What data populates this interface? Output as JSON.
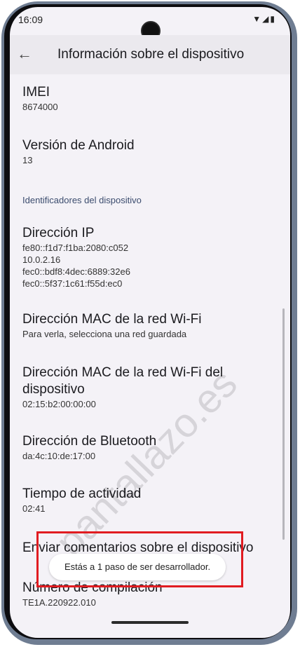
{
  "status_bar": {
    "time": "16:09",
    "icons": "wifi-icon signal-icon battery-icon"
  },
  "header": {
    "back_icon": "arrow-back-icon",
    "title": "Información sobre el dispositivo"
  },
  "items": [
    {
      "title": "IMEI",
      "lines": [
        "8674000"
      ]
    },
    {
      "title": "Versión de Android",
      "lines": [
        "13"
      ]
    },
    {
      "section": "Identificadores del dispositivo"
    },
    {
      "title": "Dirección IP",
      "lines": [
        "fe80::f1d7:f1ba:2080:c052",
        "10.0.2.16",
        "fec0::bdf8:4dec:6889:32e6",
        "fec0::5f37:1c61:f55d:ec0"
      ]
    },
    {
      "title": "Dirección MAC de la red Wi-Fi",
      "lines": [
        "Para verla, selecciona una red guardada"
      ]
    },
    {
      "title": "Dirección MAC de la red Wi-Fi del dispositivo",
      "lines": [
        "02:15:b2:00:00:00"
      ]
    },
    {
      "title": "Dirección de Bluetooth",
      "lines": [
        "da:4c:10:de:17:00"
      ]
    },
    {
      "title": "Tiempo de actividad",
      "lines": [
        "02:41"
      ]
    },
    {
      "title": "Enviar comentarios sobre el dispositivo",
      "lines": []
    },
    {
      "title": "Número de compilación",
      "lines": [
        "TE1A.220922.010"
      ]
    }
  ],
  "toast": {
    "text": "Estás a 1 paso de ser desarrollador."
  },
  "watermark": {
    "text": "pantallazo.es"
  }
}
